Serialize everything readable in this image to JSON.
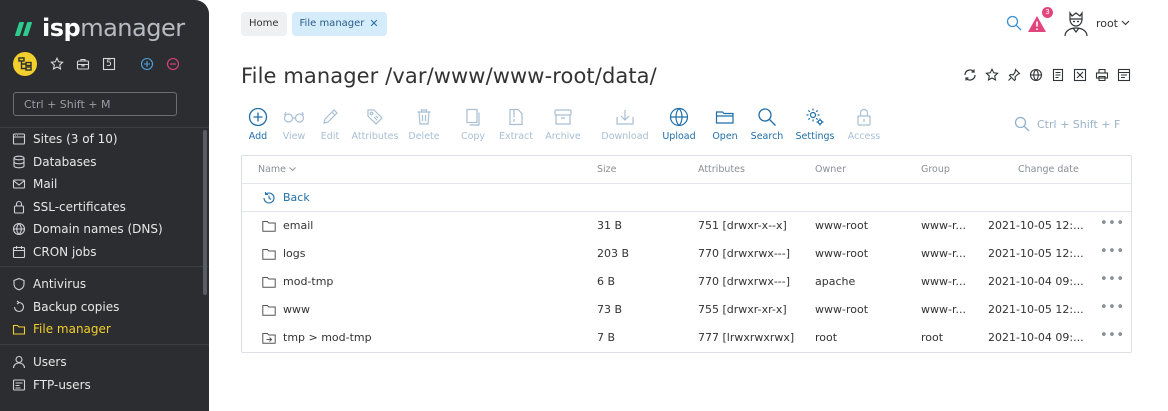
{
  "app": {
    "logo_isp": "isp",
    "logo_manager": "manager"
  },
  "sidebar": {
    "quick_count": "5",
    "search_placeholder": "Ctrl + Shift + M",
    "groups": [
      {
        "items": [
          {
            "label": "Sites (3 of 10)",
            "icon": "globe-icon"
          },
          {
            "label": "Databases",
            "icon": "database-icon"
          },
          {
            "label": "Mail",
            "icon": "mail-icon"
          },
          {
            "label": "SSL-certificates",
            "icon": "lock-icon"
          },
          {
            "label": "Domain names (DNS)",
            "icon": "globe-icon"
          },
          {
            "label": "CRON jobs",
            "icon": "calendar-icon"
          }
        ]
      },
      {
        "items": [
          {
            "label": "Antivirus",
            "icon": "shield-icon"
          },
          {
            "label": "Backup copies",
            "icon": "backup-icon"
          },
          {
            "label": "File manager",
            "icon": "folder-icon",
            "active": true
          }
        ]
      },
      {
        "items": [
          {
            "label": "Users",
            "icon": "user-icon"
          },
          {
            "label": "FTP-users",
            "icon": "ftp-icon"
          }
        ]
      }
    ]
  },
  "breadcrumbs": {
    "home": "Home",
    "active": "File manager"
  },
  "topbar": {
    "alert_count": "3",
    "username": "root"
  },
  "page": {
    "title": "File manager /var/www/www-root/data/"
  },
  "toolbar": {
    "buttons": [
      {
        "label": "Add",
        "enabled": true
      },
      {
        "label": "View",
        "enabled": false
      },
      {
        "label": "Edit",
        "enabled": false
      },
      {
        "label": "Attributes",
        "enabled": false
      },
      {
        "label": "Delete",
        "enabled": false
      },
      {
        "label": "Copy",
        "enabled": false
      },
      {
        "label": "Extract",
        "enabled": false
      },
      {
        "label": "Archive",
        "enabled": false
      },
      {
        "label": "Download",
        "enabled": false
      },
      {
        "label": "Upload",
        "enabled": true
      },
      {
        "label": "Open",
        "enabled": true
      },
      {
        "label": "Search",
        "enabled": true
      },
      {
        "label": "Settings",
        "enabled": true
      },
      {
        "label": "Access",
        "enabled": false
      }
    ],
    "search_hint": "Ctrl + Shift + F"
  },
  "table": {
    "columns": {
      "name": "Name",
      "size": "Size",
      "attributes": "Attributes",
      "owner": "Owner",
      "group": "Group",
      "date": "Change date"
    },
    "back_label": "Back",
    "rows": [
      {
        "name": "email",
        "size": "31 B",
        "attributes": "751 [drwxr-x--x]",
        "owner": "www-root",
        "group": "www-r...",
        "date": "2021-10-05 12:...",
        "type": "folder"
      },
      {
        "name": "logs",
        "size": "203 B",
        "attributes": "770 [drwxrwx---]",
        "owner": "www-root",
        "group": "www-r...",
        "date": "2021-10-05 12:...",
        "type": "folder"
      },
      {
        "name": "mod-tmp",
        "size": "6 B",
        "attributes": "770 [drwxrwx---]",
        "owner": "apache",
        "group": "www-r...",
        "date": "2021-10-04 09:...",
        "type": "folder"
      },
      {
        "name": "www",
        "size": "73 B",
        "attributes": "755 [drwxr-xr-x]",
        "owner": "www-root",
        "group": "www-r...",
        "date": "2021-10-05 12:...",
        "type": "folder"
      },
      {
        "name": "tmp > mod-tmp",
        "size": "7 B",
        "attributes": "777 [lrwxrwxrwx]",
        "owner": "root",
        "group": "root",
        "date": "2021-10-04 09:...",
        "type": "symlink"
      }
    ]
  },
  "colors": {
    "sidebar_bg": "#2b2d30",
    "accent_yellow": "#f2cf2c",
    "link_blue": "#1f6ea8",
    "disabled_blue": "#a8bfd3",
    "logo_green": "#2fca8e",
    "alert_pink": "#e0457b"
  }
}
